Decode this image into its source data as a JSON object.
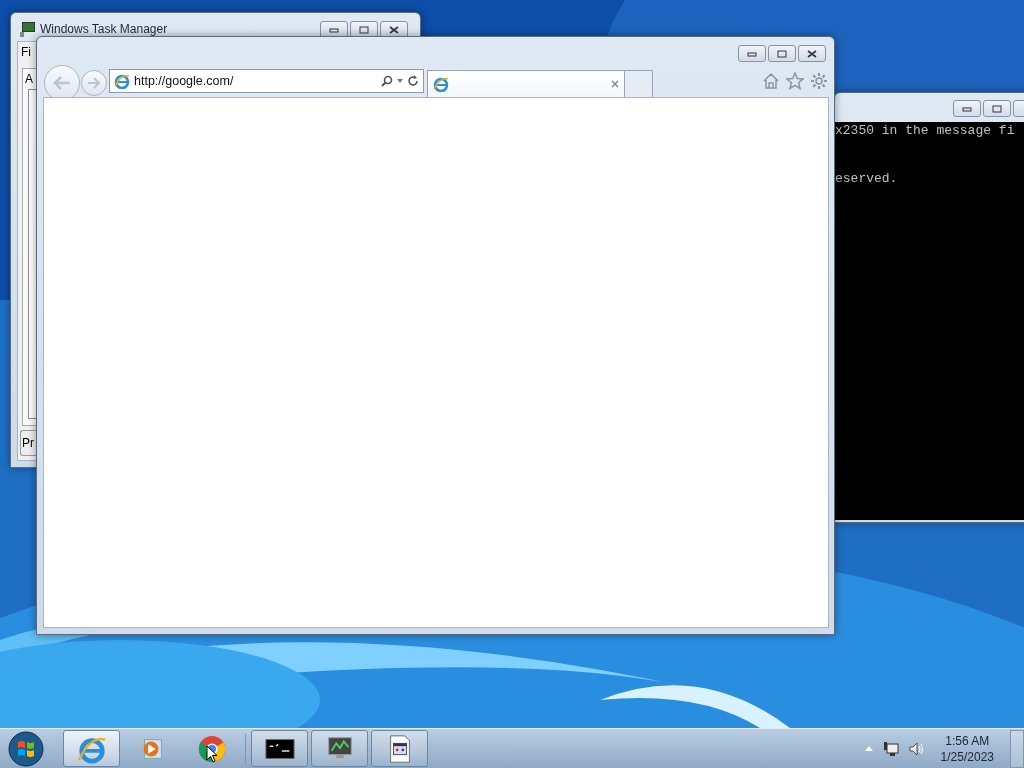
{
  "task_manager": {
    "title": "Windows Task Manager",
    "menu_label": "Fi",
    "tab_label": "A",
    "button_label": "Pr"
  },
  "console": {
    "lines": [
      "x2350 in the message fi",
      "eserved."
    ]
  },
  "browser": {
    "address": "http://google.com/",
    "tab": {
      "selected": true
    }
  },
  "taskbar": {
    "items": [
      {
        "kind": "ie",
        "running": true,
        "selected": true
      },
      {
        "kind": "media",
        "running": false,
        "selected": false
      },
      {
        "kind": "chrome",
        "running": false,
        "selected": false
      },
      {
        "kind": "console",
        "running": true,
        "selected": false
      },
      {
        "kind": "monitor",
        "running": true,
        "selected": false
      },
      {
        "kind": "document",
        "running": true,
        "selected": false
      }
    ],
    "time": "1:56 AM",
    "date": "1/25/2023"
  }
}
